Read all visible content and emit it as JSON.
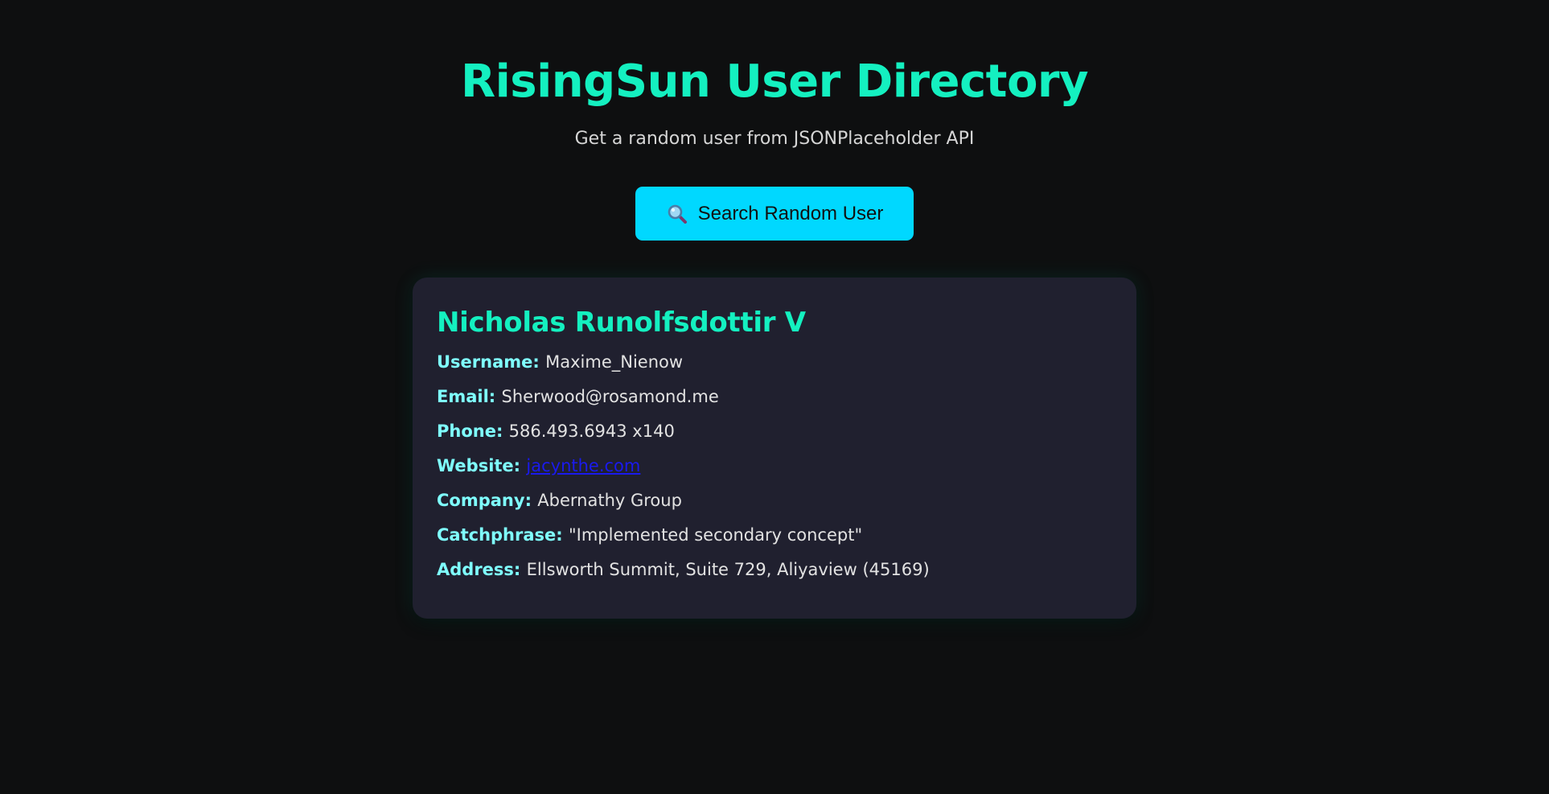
{
  "colors": {
    "background": "#0e0f10",
    "accent": "#14f0c0",
    "button": "#00d8ff",
    "card": "#20202f",
    "label": "#7fffff",
    "link": "#1a1aee"
  },
  "header": {
    "title": "RisingSun User Directory",
    "subtitle": "Get a random user from JSONPlaceholder API"
  },
  "search_button": {
    "icon": "magnifying-glass-icon",
    "label": "Search Random User"
  },
  "user_card": {
    "name": "Nicholas Runolfsdottir V",
    "fields": [
      {
        "label": "Username:",
        "value": "Maxime_Nienow"
      },
      {
        "label": "Email:",
        "value": "Sherwood@rosamond.me"
      },
      {
        "label": "Phone:",
        "value": "586.493.6943 x140"
      },
      {
        "label": "Website:",
        "value": "jacynthe.com"
      },
      {
        "label": "Company:",
        "value": "Abernathy Group"
      },
      {
        "label": "Catchphrase:",
        "value": "\"Implemented secondary concept\""
      },
      {
        "label": "Address:",
        "value": "Ellsworth Summit, Suite 729, Aliyaview (45169)"
      }
    ]
  }
}
